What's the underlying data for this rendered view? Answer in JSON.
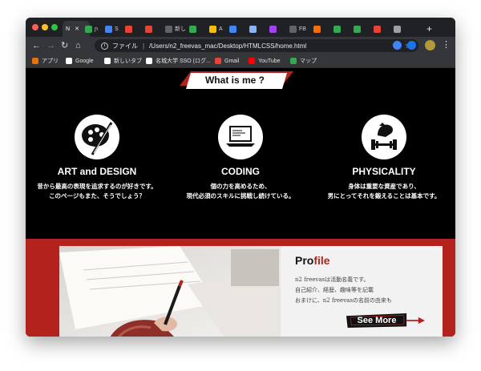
{
  "browser": {
    "tabs": [
      {
        "label": "N",
        "color": "#1a73e8"
      },
      {
        "label": "ɲ",
        "color": "#34a853"
      },
      {
        "label": "S",
        "color": "#4285f4"
      },
      {
        "label": "",
        "color": "#ea4335"
      },
      {
        "label": "",
        "color": "#ea4335"
      },
      {
        "label": "新し",
        "color": "#5f6368"
      },
      {
        "label": "",
        "color": "#34a853"
      },
      {
        "label": "A",
        "color": "#fbbc04"
      },
      {
        "label": "",
        "color": "#4285f4"
      },
      {
        "label": "",
        "color": "#8ab4f8"
      },
      {
        "label": "",
        "color": "#a142f4"
      },
      {
        "label": "FB",
        "color": "#5f6368"
      },
      {
        "label": "",
        "color": "#ff6d00"
      },
      {
        "label": "",
        "color": "#34a853"
      },
      {
        "label": "",
        "color": "#34a853"
      },
      {
        "label": "",
        "color": "#ea4335"
      },
      {
        "label": "",
        "color": "#9aa0a6"
      }
    ],
    "new_tab_label": "+",
    "omnibox": {
      "info_label": "ファイル",
      "url": "/Users/n2_freevas_mac/Desktop/HTMLCSS/home.html"
    },
    "bookmarks": [
      {
        "label": "アプリ",
        "icon": "apps-grid-icon",
        "color": "#e8710a"
      },
      {
        "label": "Google",
        "icon": "google-icon",
        "color": "#ffffff"
      },
      {
        "label": "新しいタブ",
        "icon": "tab-icon",
        "color": "#ffffff"
      },
      {
        "label": "名城大学 SSO (ログ...",
        "icon": "sso-icon",
        "color": "#ffffff"
      },
      {
        "label": "Gmail",
        "icon": "gmail-icon",
        "color": "#ea4335"
      },
      {
        "label": "YouTube",
        "icon": "youtube-icon",
        "color": "#ff0000"
      },
      {
        "label": "マップ",
        "icon": "maps-icon",
        "color": "#34a853"
      }
    ]
  },
  "page": {
    "section_title": "What is me ?",
    "features": [
      {
        "title": "ART and DESIGN",
        "icon": "palette-icon",
        "desc_line1": "昔から最高の表現を追求するのが好きです。",
        "desc_line2": "このページもまた、そうでしょう？"
      },
      {
        "title": "CODING",
        "icon": "laptop-icon",
        "desc_line1": "個の力を高めるため、",
        "desc_line2": "現代必須のスキルに挑戦し続けている。"
      },
      {
        "title": "PHYSICALITY",
        "icon": "strength-icon",
        "desc_line1": "身体は重要な資産であり、",
        "desc_line2": "男にとってそれを鍛えることは基本です。"
      }
    ],
    "profile": {
      "title_pre": "Pro",
      "title_accent": "file",
      "lines": [
        "n2 freevasは活動名義です。",
        "自己紹介、経歴、趣味等を記載",
        "おまけに、n2 freevasの名前の由来も"
      ],
      "button_label": "See More"
    },
    "colors": {
      "accent_red": "#b3221c",
      "background": "#000000"
    }
  }
}
